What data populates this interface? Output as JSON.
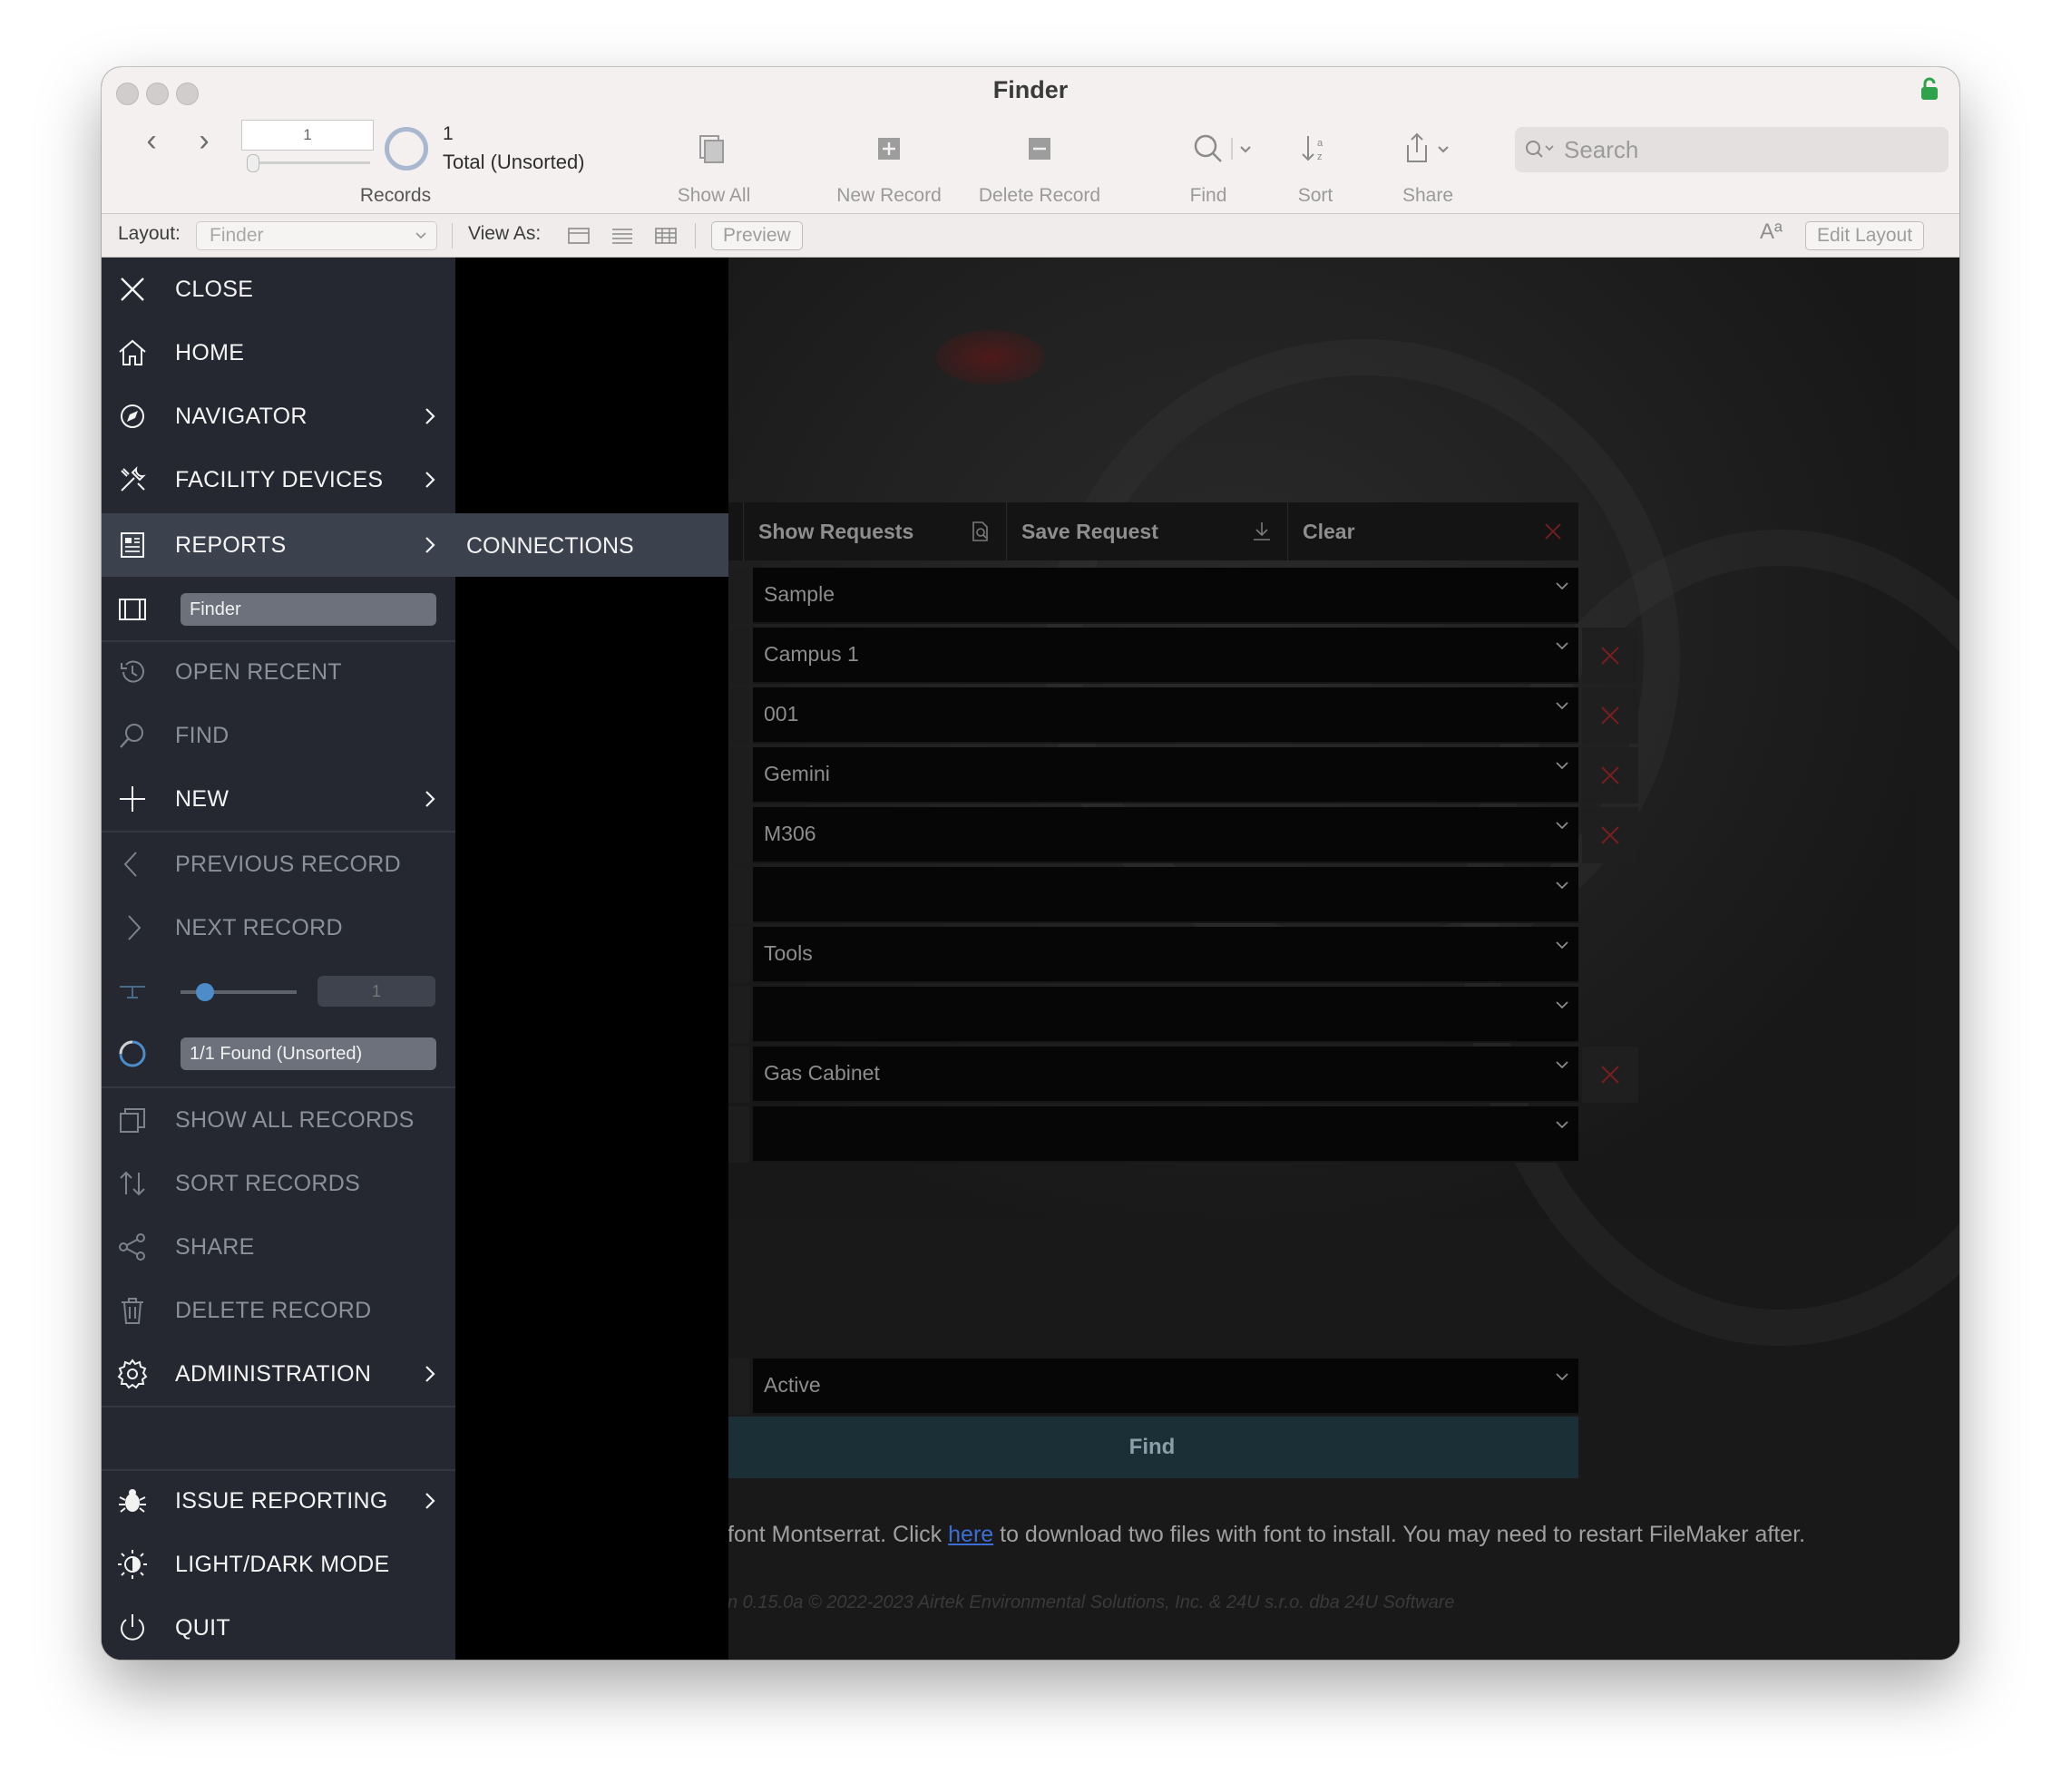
{
  "window": {
    "title": "Finder"
  },
  "toolbar": {
    "record_value": "1",
    "record_count": "1",
    "record_total": "Total (Unsorted)",
    "records_label": "Records",
    "show_all_label": "Show All",
    "new_record_label": "New Record",
    "delete_record_label": "Delete Record",
    "find_label": "Find",
    "sort_label": "Sort",
    "share_label": "Share",
    "search_placeholder": "Search"
  },
  "layout_bar": {
    "layout_label": "Layout:",
    "layout_value": "Finder",
    "view_as_label": "View As:",
    "preview_label": "Preview",
    "text_size_glyph": "Aª",
    "edit_layout_label": "Edit Layout"
  },
  "sidebar": {
    "items": [
      {
        "label": "CLOSE",
        "icon": "close-icon"
      },
      {
        "label": "HOME",
        "icon": "home-icon"
      },
      {
        "label": "NAVIGATOR",
        "icon": "compass-icon"
      },
      {
        "label": "FACILITY DEVICES",
        "icon": "tools-icon"
      },
      {
        "label": "REPORTS",
        "icon": "report-icon"
      },
      {
        "label": "OPEN RECENT",
        "icon": "history-icon"
      },
      {
        "label": "FIND",
        "icon": "search-icon"
      },
      {
        "label": "NEW",
        "icon": "plus-icon"
      },
      {
        "label": "PREVIOUS RECORD",
        "icon": "chevron-left-icon"
      },
      {
        "label": "NEXT RECORD",
        "icon": "chevron-right-icon"
      },
      {
        "label": "SHOW ALL RECORDS",
        "icon": "copy-icon"
      },
      {
        "label": "SORT RECORDS",
        "icon": "sort-icon"
      },
      {
        "label": "SHARE",
        "icon": "share-icon"
      },
      {
        "label": "DELETE RECORD",
        "icon": "trash-icon"
      },
      {
        "label": "ADMINISTRATION",
        "icon": "gear-icon"
      },
      {
        "label": "ISSUE REPORTING",
        "icon": "bug-icon"
      },
      {
        "label": "LIGHT/DARK MODE",
        "icon": "contrast-icon"
      },
      {
        "label": "QUIT",
        "icon": "power-icon"
      }
    ],
    "layout_pill": "Finder",
    "record_number": "1",
    "found_text": "1/1 Found (Unsorted)"
  },
  "submenu": {
    "items": [
      {
        "label": "CONNECTIONS"
      }
    ]
  },
  "action_bar": {
    "show_requests": "Show Requests",
    "save_request": "Save Request",
    "clear": "Clear"
  },
  "fields": [
    {
      "value": "Sample",
      "removable": false
    },
    {
      "value": "Campus 1",
      "removable": true
    },
    {
      "value": "001",
      "removable": true
    },
    {
      "value": "Gemini",
      "removable": true
    },
    {
      "value": "M306",
      "removable": true
    },
    {
      "value": "",
      "removable": false
    },
    {
      "value": "Tools",
      "removable": false
    },
    {
      "value": "",
      "removable": false
    },
    {
      "value": "Gas Cabinet",
      "removable": true
    },
    {
      "value": "",
      "removable": false
    }
  ],
  "status_field": {
    "value": "Active"
  },
  "find_button": "Find",
  "font_note": {
    "prefix": "font Montserrat. Click ",
    "link": "here",
    "suffix": " to download two files with font to install. You may need to restart FileMaker after."
  },
  "copyright": "n 0.15.0a © 2022-2023 Airtek Environmental Solutions, Inc. & 24U s.r.o. dba 24U Software",
  "colors": {
    "sidebar": "#252830",
    "active_item": "#3b414d",
    "accent_blue": "#4b8cc9",
    "remove_red": "#7a1e1e"
  }
}
